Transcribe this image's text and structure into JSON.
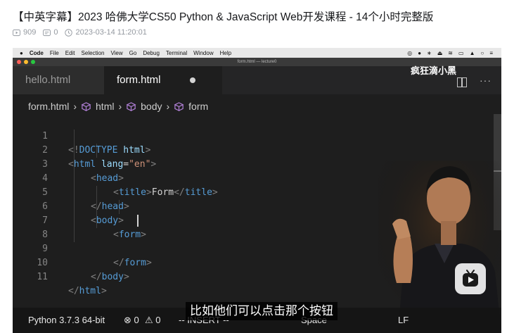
{
  "video": {
    "title": "【中英字幕】2023 哈佛大学CS50 Python & JavaScript Web开发课程 - 14个小时完整版",
    "views": "909",
    "danmaku": "0",
    "date": "2023-03-14 11:20:01"
  },
  "mac_menu": {
    "apple": "",
    "app": "Code",
    "items": [
      "File",
      "Edit",
      "Selection",
      "View",
      "Go",
      "Debug",
      "Terminal",
      "Window",
      "Help"
    ]
  },
  "window": {
    "title": "form.html — lecture0"
  },
  "tabs": [
    {
      "label": "hello.html"
    },
    {
      "label": "form.html"
    }
  ],
  "watermark": {
    "channel": "疯狂滴小黑",
    "logo": "bilibili"
  },
  "breadcrumb": [
    "form.html",
    "html",
    "body",
    "form"
  ],
  "code": {
    "line_numbers": [
      "1",
      "2",
      "3",
      "4",
      "5",
      "6",
      "7",
      "8",
      "9",
      "10",
      "11"
    ],
    "doctype_open": "<!",
    "doctype_kw": "DOCTYPE",
    "doctype_html": " html",
    "doctype_close": ">",
    "html_tag": "html",
    "attr_lang": " lang",
    "attr_eq": "=",
    "attr_val": "\"en\"",
    "head": "head",
    "title": "title",
    "title_text": "Form",
    "body": "body",
    "form": "form",
    "lt": "<",
    "gt": ">",
    "lt_slash": "</"
  },
  "status": {
    "python": "Python 3.7.3 64-bit",
    "errors": "⊗ 0",
    "warnings": "⚠ 0",
    "mode": "-- INSERT --",
    "spaces": "Space",
    "eol": "LF"
  },
  "subtitle": "比如他们可以点击那个按钮",
  "colors": {
    "editor_bg": "#1e1e1e",
    "tag": "#569cd6",
    "attr": "#9cdcfe",
    "string": "#ce9178",
    "bracket": "#808080"
  }
}
